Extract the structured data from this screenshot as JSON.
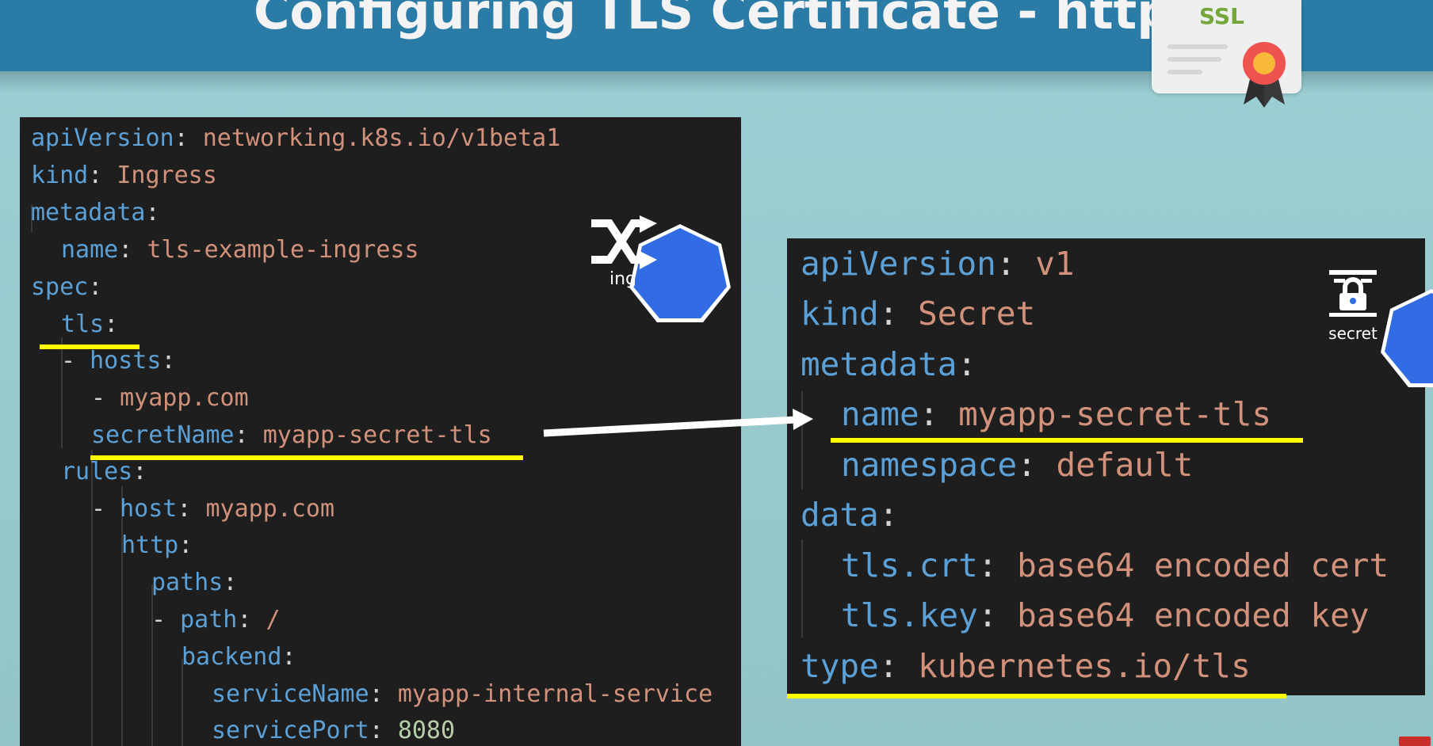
{
  "slide": {
    "title": "Configuring TLS Certificate - https//"
  },
  "ssl_card": {
    "label": "SSL",
    "seal_icon": "award-ribbon-icon"
  },
  "ingress_yaml": {
    "lines": [
      {
        "key": "apiVersion",
        "sep": ": ",
        "value": "networking.k8s.io/v1beta1"
      },
      {
        "key": "kind",
        "sep": ": ",
        "value": "Ingress"
      },
      {
        "key": "metadata",
        "sep": ":",
        "value": ""
      },
      {
        "key": "name",
        "sep": ": ",
        "value": "tls-example-ingress"
      },
      {
        "key": "spec",
        "sep": ":",
        "value": ""
      },
      {
        "key": "tls",
        "sep": ":",
        "value": ""
      },
      {
        "dash": "- ",
        "key": "hosts",
        "sep": ":",
        "value": ""
      },
      {
        "dash": "- ",
        "key": "",
        "sep": "",
        "value": "myapp.com"
      },
      {
        "key": "secretName",
        "sep": ": ",
        "value": "myapp-secret-tls"
      },
      {
        "key": "rules",
        "sep": ":",
        "value": ""
      },
      {
        "dash": "- ",
        "key": "host",
        "sep": ": ",
        "value": "myapp.com"
      },
      {
        "key": "http",
        "sep": ":",
        "value": ""
      },
      {
        "key": "paths",
        "sep": ":",
        "value": ""
      },
      {
        "dash": "- ",
        "key": "path",
        "sep": ": ",
        "value": "/"
      },
      {
        "key": "backend",
        "sep": ":",
        "value": ""
      },
      {
        "key": "serviceName",
        "sep": ": ",
        "value": "myapp-internal-service"
      },
      {
        "key": "servicePort",
        "sep": ": ",
        "value": "8080",
        "numeric": true
      }
    ],
    "badge_label": "ing",
    "badge_icon": "shuffle-arrows-icon",
    "badge_color": "#326ce5"
  },
  "secret_yaml": {
    "lines": [
      {
        "key": "apiVersion",
        "sep": ": ",
        "value": "v1"
      },
      {
        "key": "kind",
        "sep": ": ",
        "value": "Secret"
      },
      {
        "key": "metadata",
        "sep": ":",
        "value": ""
      },
      {
        "key": "name",
        "sep": ": ",
        "value": "myapp-secret-tls"
      },
      {
        "key": "namespace",
        "sep": ": ",
        "value": "default"
      },
      {
        "key": "data",
        "sep": ":",
        "value": ""
      },
      {
        "key": "tls.crt",
        "sep": ": ",
        "value": "base64 encoded cert"
      },
      {
        "key": "tls.key",
        "sep": ": ",
        "value": "base64 encoded key"
      },
      {
        "key": "type",
        "sep": ": ",
        "value": "kubernetes.io/tls"
      }
    ],
    "badge_label": "secret",
    "badge_icon": "lock-icon",
    "badge_color": "#326ce5"
  },
  "colors": {
    "key": "#5ba1d8",
    "string_value": "#d2917b",
    "number_value": "#b5cea8",
    "highlight": "#ffff00",
    "banner": "#2a7ba6",
    "background": "#9ccfd3"
  }
}
